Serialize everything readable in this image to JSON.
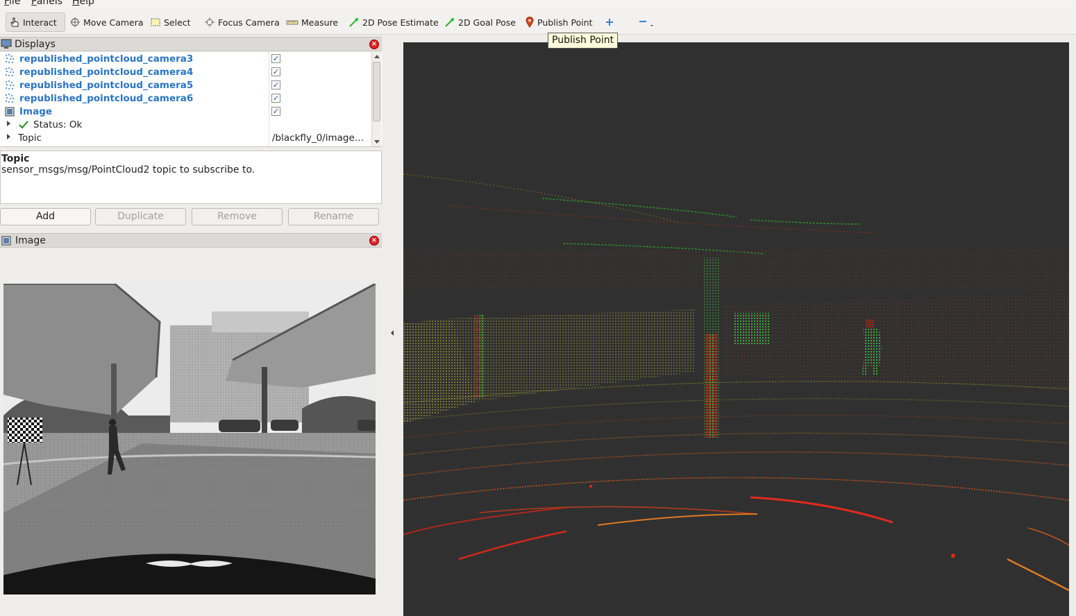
{
  "menu": [
    "File",
    "Panels",
    "Help"
  ],
  "toolbar": {
    "interact": "Interact",
    "move_camera": "Move Camera",
    "select": "Select",
    "focus_camera": "Focus Camera",
    "measure": "Measure",
    "pose_estimate": "2D Pose Estimate",
    "goal_pose": "2D Goal Pose",
    "publish_point": "Publish Point"
  },
  "tooltip": "Publish Point",
  "displays_panel": {
    "title": "Displays",
    "items": [
      {
        "label": "republished_pointcloud_camera3",
        "checked": true
      },
      {
        "label": "republished_pointcloud_camera4",
        "checked": true
      },
      {
        "label": "republished_pointcloud_camera5",
        "checked": true
      },
      {
        "label": "republished_pointcloud_camera6",
        "checked": true
      },
      {
        "label": "Image",
        "checked": true
      }
    ],
    "status_label": "Status: Ok",
    "topic_label": "Topic",
    "topic_value": "/blackfly_0/image…"
  },
  "description": {
    "title": "Topic",
    "text": "sensor_msgs/msg/PointCloud2 topic to subscribe to."
  },
  "buttons": {
    "add": "Add",
    "duplicate": "Duplicate",
    "remove": "Remove",
    "rename": "Rename"
  },
  "image_panel": {
    "title": "Image"
  },
  "colors": {
    "accent_blue": "#2a74c2",
    "viewport_bg": "#303030",
    "point_green": "#3ecf3e",
    "point_red": "#e02a1e",
    "point_orange": "#e07a20"
  }
}
